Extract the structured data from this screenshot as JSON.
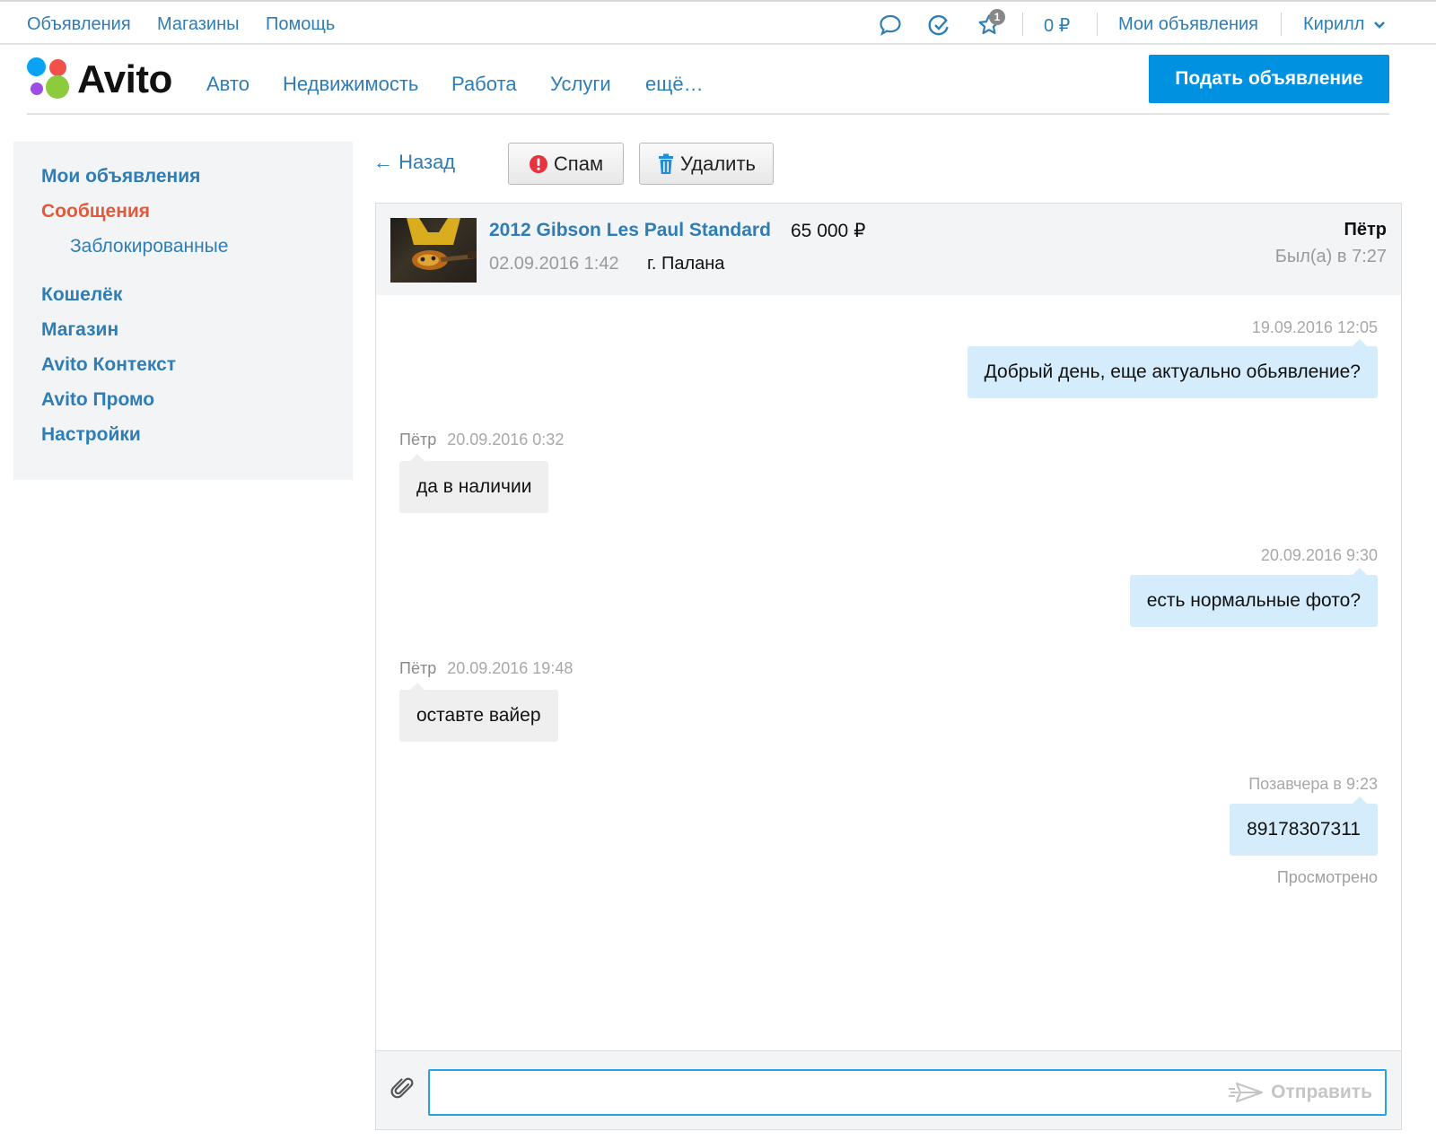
{
  "topbar": {
    "links": [
      "Объявления",
      "Магазины",
      "Помощь"
    ],
    "favorites_badge": "1",
    "balance": "0 ₽",
    "my_ads": "Мои объявления",
    "user": "Кирилл"
  },
  "header": {
    "logo_text": "Avito",
    "categories": [
      "Авто",
      "Недвижимость",
      "Работа",
      "Услуги",
      "ещё…"
    ],
    "post_button": "Подать объявление"
  },
  "sidebar": {
    "items": [
      {
        "label": "Мои объявления"
      },
      {
        "label": "Сообщения"
      },
      {
        "label": "Заблокированные"
      },
      {
        "label": "Кошелёк"
      },
      {
        "label": "Магазин"
      },
      {
        "label": "Avito Контекст"
      },
      {
        "label": "Avito Промо"
      },
      {
        "label": "Настройки"
      }
    ]
  },
  "toolbar": {
    "back": "← Назад",
    "spam": "Спам",
    "delete": "Удалить"
  },
  "ad": {
    "title": "2012 Gibson Les Paul Standard",
    "price": "65 000 ₽",
    "date": "02.09.2016 1:42",
    "city": "г. Палана"
  },
  "peer": {
    "name": "Пётр",
    "last_seen": "Был(а) в 7:27"
  },
  "messages": [
    {
      "dir": "out",
      "time": "19.09.2016 12:05",
      "text": "Добрый день, еще актуально обьявление?"
    },
    {
      "dir": "in",
      "author": "Пётр",
      "time": "20.09.2016 0:32",
      "text": "да в наличии"
    },
    {
      "dir": "out",
      "time": "20.09.2016 9:30",
      "text": "есть нормальные фото?"
    },
    {
      "dir": "in",
      "author": "Пётр",
      "time": "20.09.2016 19:48",
      "text": "оставте вайер"
    },
    {
      "dir": "out",
      "time": "Позавчера в 9:23",
      "text": "89178307311"
    }
  ],
  "read_status": "Просмотрено",
  "composer": {
    "value": "",
    "send": "Отправить"
  },
  "colors": {
    "link": "#2f7db5",
    "active": "#e25a39",
    "primary_button": "#0091e0",
    "bubble_out": "#d4ecfb",
    "bubble_in": "#efefef"
  }
}
